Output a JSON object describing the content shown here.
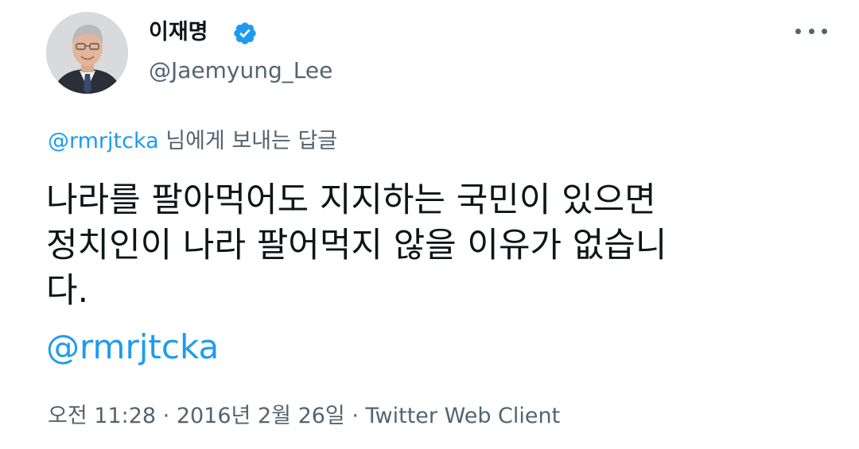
{
  "author": {
    "display_name": "이재명",
    "handle": "@Jaemyung_Lee",
    "verified": true
  },
  "reply": {
    "mention": "@rmrjtcka",
    "suffix": " 님에게 보내는 답글"
  },
  "tweet": {
    "lines": [
      "나라를 팔아먹어도 지지하는 국민이 있으면",
      "정치인이 나라 팔어먹지 않을 이유가 없습니",
      "다."
    ],
    "mention": "@rmrjtcka"
  },
  "meta": {
    "time": "오전 11:28",
    "separator": " · ",
    "date": "2016년 2월 26일",
    "separator2": " · ",
    "source": "Twitter Web Client"
  },
  "icons": {
    "verified": "verified-badge-icon",
    "more": "more-horizontal-icon"
  },
  "colors": {
    "accent": "#1d9bf0",
    "text": "#0f1419",
    "secondary": "#536471"
  }
}
